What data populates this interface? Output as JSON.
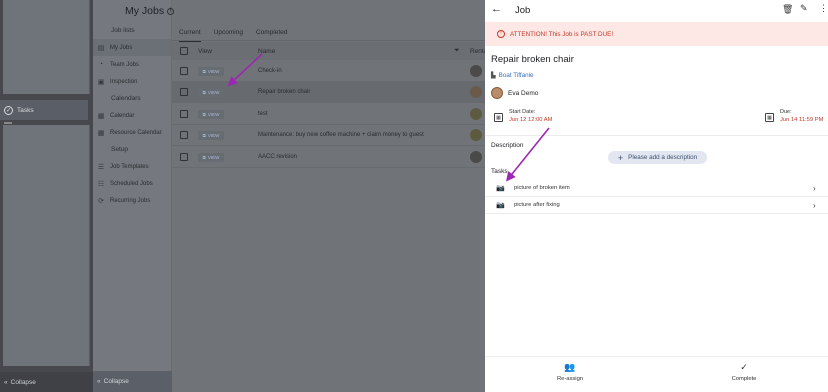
{
  "rail": {
    "tasks_label": "Tasks",
    "collapse_label": "Collapse"
  },
  "nav": {
    "sections": [
      "Job lists",
      "Calendars",
      "Setup"
    ],
    "job_items": [
      {
        "label": "My Jobs",
        "icon": "list-icon"
      },
      {
        "label": "Team Jobs",
        "icon": "team-icon"
      },
      {
        "label": "Inspection",
        "icon": "inspection-icon"
      }
    ],
    "calendar_items": [
      {
        "label": "Calendar",
        "icon": "calendar-icon"
      },
      {
        "label": "Resource Calendar",
        "icon": "calendar-icon"
      }
    ],
    "setup_items": [
      {
        "label": "Job Templates",
        "icon": "template-icon"
      },
      {
        "label": "Scheduled Jobs",
        "icon": "schedule-icon"
      },
      {
        "label": "Recurring Jobs",
        "icon": "recurring-icon"
      }
    ],
    "collapse_label": "Collapse"
  },
  "main": {
    "title": "My Jobs",
    "tabs": [
      "Current",
      "Upcoming",
      "Completed"
    ],
    "columns": {
      "view": "View",
      "name": "Name",
      "rental": "Renta"
    },
    "view_button_label": "VIEW",
    "rows": [
      {
        "name": "Check-in"
      },
      {
        "name": "Repair broken chair"
      },
      {
        "name": "test"
      },
      {
        "name": "Maintenance: buy new coffee machine + claim money to guest"
      },
      {
        "name": "AACC revision"
      }
    ]
  },
  "detail": {
    "title": "Job",
    "alert": "ATTENTION! This Job is PAST DUE!",
    "job_title": "Repair broken chair",
    "location": "Boat Tiffanie",
    "assignee": "Eva Demo",
    "start": {
      "label": "Start Date:",
      "value": "Jun 12 12:00 AM"
    },
    "due": {
      "label": "Due:",
      "value": "Jun 14 11:59 PM"
    },
    "description_label": "Description",
    "add_description": "Please add a description",
    "tasks_label": "Tasks",
    "tasks": [
      {
        "label": "picture of broken item"
      },
      {
        "label": "picture after fixing"
      }
    ],
    "bottom": {
      "reassign": "Re-assign",
      "complete": "Complete"
    }
  },
  "colors": {
    "alert_bg": "#fde8e6",
    "alert_text": "#c0392b",
    "link": "#3b6fc0",
    "arrow": "#9c27b0",
    "overlay": "#707378"
  }
}
